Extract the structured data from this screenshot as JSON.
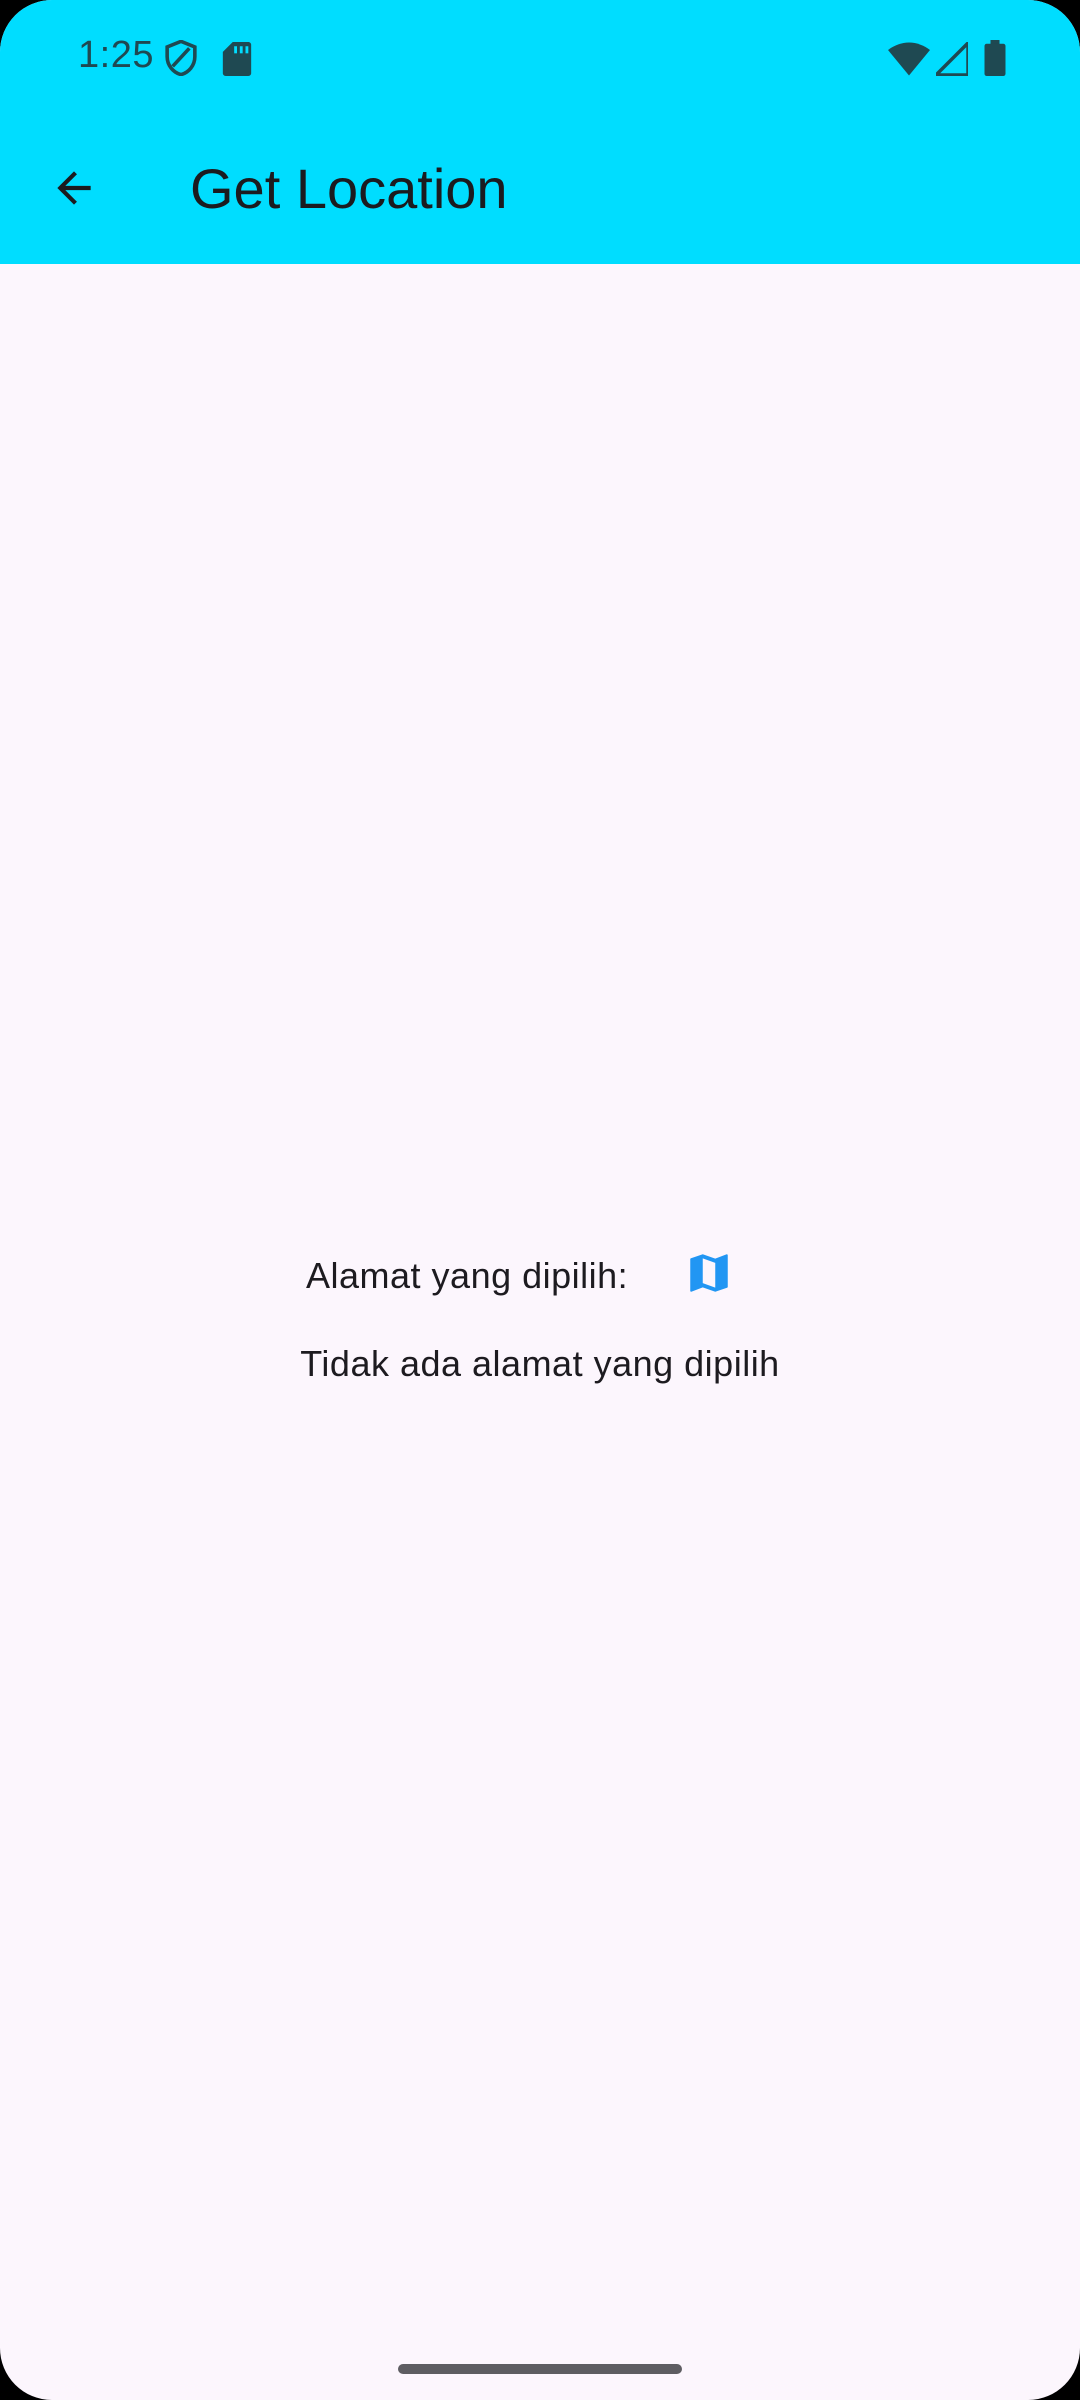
{
  "status_bar": {
    "time": "1:25",
    "icons": [
      "shield-icon",
      "sd-card-icon",
      "wifi-icon",
      "signal-icon",
      "battery-icon"
    ]
  },
  "app_bar": {
    "title": "Get Location",
    "back_icon": "arrow-back-icon",
    "background_color": "#00DDFF"
  },
  "main": {
    "address_label": "Alamat yang dipilih:",
    "map_icon": "map-icon",
    "map_icon_color": "#2196F3",
    "no_address_text": "Tidak ada alamat yang dipilih"
  }
}
